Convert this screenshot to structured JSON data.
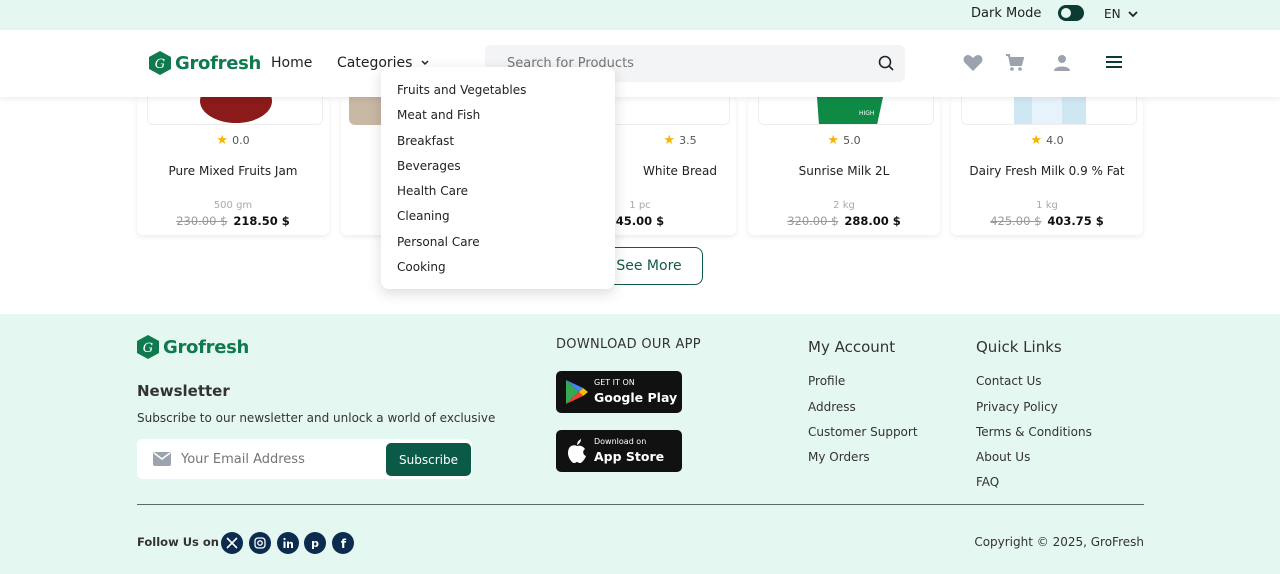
{
  "topbar": {
    "dark_mode_label": "Dark Mode",
    "language": "EN"
  },
  "header": {
    "brand": "Grofresh",
    "nav_home": "Home",
    "nav_categories": "Categories",
    "search_placeholder": "Search for Products"
  },
  "categories_menu": [
    "Fruits and Vegetables",
    "Meat and Fish",
    "Breakfast",
    "Beverages",
    "Health Care",
    "Cleaning",
    "Personal Care",
    "Cooking"
  ],
  "products": [
    {
      "name": "Pure Mixed Fruits Jam",
      "rating": "0.0",
      "qty": "500 gm",
      "old_price": "230.00 $",
      "price": "218.50 $"
    },
    {
      "name": "White Bread",
      "rating": "3.5",
      "qty": "1 pc",
      "old_price": "",
      "price": "45.00 $"
    },
    {
      "name": "Sunrise Milk 2L",
      "rating": "5.0",
      "qty": "2 kg",
      "old_price": "320.00 $",
      "price": "288.00 $"
    },
    {
      "name": "Dairy Fresh Milk 0.9 % Fat",
      "rating": "4.0",
      "qty": "1 kg",
      "old_price": "425.00 $",
      "price": "403.75 $"
    }
  ],
  "see_more": "See More",
  "footer": {
    "brand": "Grofresh",
    "newsletter_title": "Newsletter",
    "newsletter_text": "Subscribe to our newsletter and unlock a world of exclusive",
    "email_placeholder": "Your Email Address",
    "subscribe_label": "Subscribe",
    "download_title": "DOWNLOAD OUR APP",
    "google_small": "GET IT ON",
    "google_big": "Google Play",
    "apple_small": "Download on",
    "apple_big": "App Store",
    "my_account_title": "My Account",
    "my_account_links": [
      "Profile",
      "Address",
      "Customer Support",
      "My Orders"
    ],
    "quick_links_title": "Quick Links",
    "quick_links": [
      "Contact Us",
      "Privacy Policy",
      "Terms & Conditions",
      "About Us",
      "FAQ"
    ],
    "follow_label": "Follow Us on",
    "copyright": "Copyright © 2025, GroFresh"
  },
  "colors": {
    "brand_green": "#0f7a4f",
    "dark_green": "#0b5a47",
    "mint_bg": "#e5f7f1",
    "star": "#f5b400"
  }
}
